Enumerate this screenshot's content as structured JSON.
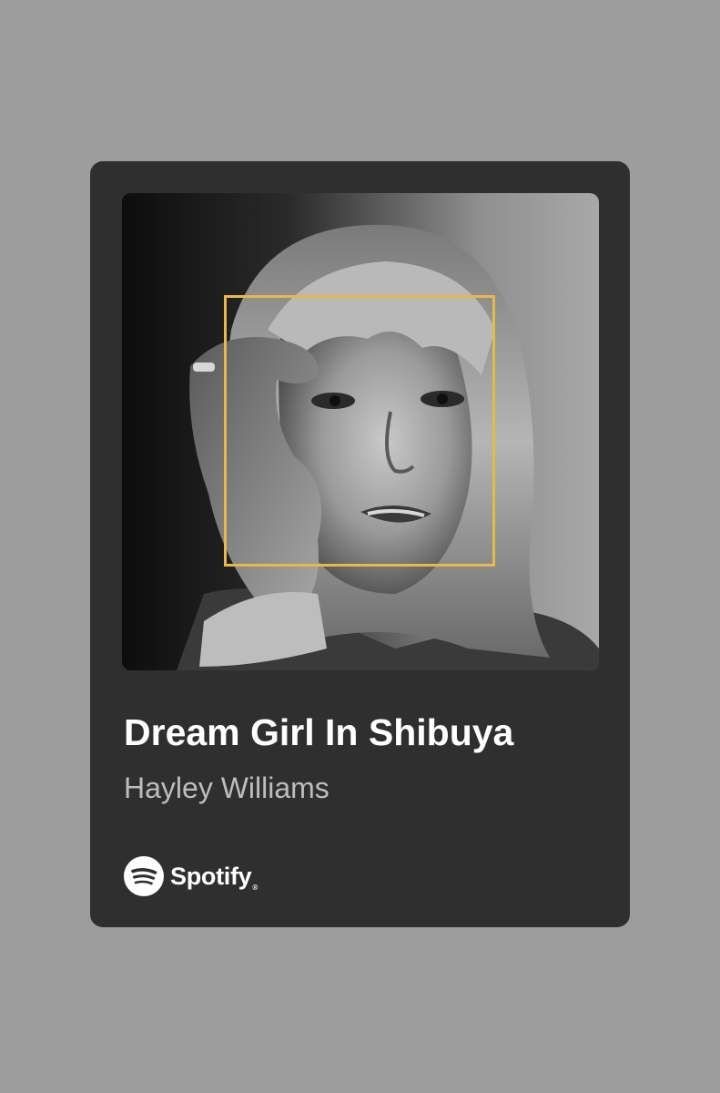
{
  "track": {
    "title": "Dream Girl In Shibuya",
    "artist": "Hayley Williams"
  },
  "brand": {
    "name": "Spotify",
    "icon": "spotify-logo-icon"
  },
  "cover": {
    "description_icon": "album-cover-image",
    "frame_color": "#e8b84a"
  },
  "colors": {
    "page_background": "#9d9d9d",
    "card_background": "#2f2f2f",
    "title_color": "#ffffff",
    "artist_color": "#bdbdbd"
  }
}
